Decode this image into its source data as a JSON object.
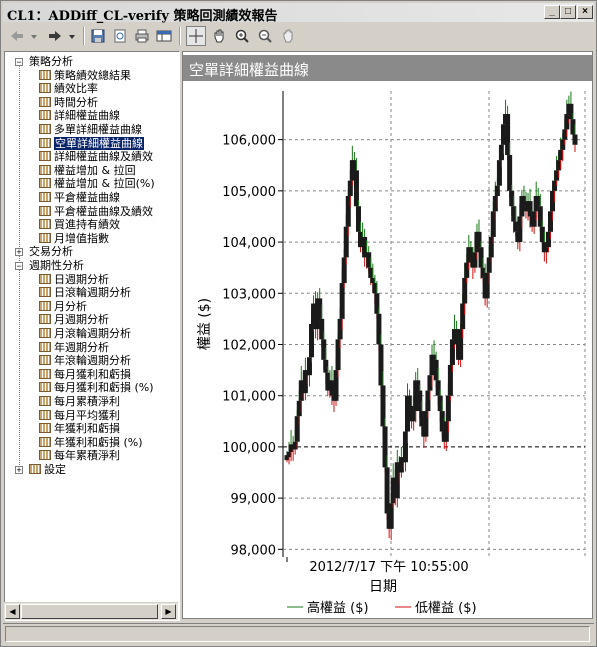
{
  "window": {
    "title": "CL1：ADDiff_CL-verify 策略回測績效報告",
    "controls": {
      "minimize": "_",
      "maximize": "□",
      "close": "×"
    }
  },
  "toolbar": {
    "icons": [
      "back-icon",
      "forward-icon",
      "save-icon",
      "preview-icon",
      "print-icon",
      "table-icon",
      "crosshair-icon",
      "hand-pan-icon",
      "zoom-in-icon",
      "zoom-out-icon",
      "reset-zoom-icon"
    ]
  },
  "tree": {
    "groups": [
      {
        "label": "策略分析",
        "expanded": true,
        "items": [
          "策略績效總結果",
          "績效比率",
          "時間分析",
          "詳細權益曲線",
          "多單詳細權益曲線",
          "空單詳細權益曲線",
          "詳細權益曲線及績效",
          "權益增加 & 拉回",
          "權益增加 & 拉回(%)",
          "平倉權益曲線",
          "平倉權益曲線及績效",
          "買進持有績效",
          "月增值指數"
        ],
        "selected": 5
      },
      {
        "label": "交易分析",
        "expanded": false,
        "items": []
      },
      {
        "label": "週期性分析",
        "expanded": true,
        "items": [
          "日週期分析",
          "日滾輪週期分析",
          "月分析",
          "月週期分析",
          "月滾輪週期分析",
          "年週期分析",
          "年滾輪週期分析",
          "每月獲利和虧損",
          "每月獲利和虧損 (%)",
          "每月累積淨利",
          "每月平均獲利",
          "年獲利和虧損",
          "年獲利和虧損 (%)",
          "每年累積淨利"
        ]
      },
      {
        "label": "設定",
        "expanded": false,
        "items": []
      }
    ]
  },
  "chart_panel": {
    "title": "空單詳細權益曲線"
  },
  "chart_data": {
    "type": "candlestick-like",
    "title": "",
    "ylabel": "權益 ($)",
    "xlabel": "日期",
    "x_tick_label": "2012/7/17 下午 10:55:00",
    "y_ticks": [
      98000,
      99000,
      100000,
      101000,
      102000,
      103000,
      104000,
      105000,
      106000
    ],
    "y_tick_labels": [
      "98,000",
      "99,000",
      "100,000",
      "101,000",
      "102,000",
      "103,000",
      "104,000",
      "105,000",
      "106,000"
    ],
    "ylim": [
      97850,
      106950
    ],
    "reference_line": 100000,
    "grid": true,
    "legend": [
      {
        "name": "高權益 ($)",
        "color": "#1a7a1a"
      },
      {
        "name": "低權益 ($)",
        "color": "#d01010"
      }
    ],
    "close_series": [
      99800,
      99900,
      100050,
      99950,
      100100,
      100600,
      100900,
      101300,
      101050,
      101500,
      101400,
      101750,
      102400,
      102800,
      102300,
      102900,
      102500,
      102100,
      101700,
      101450,
      101100,
      101300,
      101000,
      100900,
      101500,
      102100,
      102500,
      103200,
      103700,
      104300,
      104900,
      105200,
      105600,
      105400,
      104700,
      104200,
      103900,
      104100,
      103700,
      103800,
      103500,
      103300,
      103200,
      103000,
      102600,
      102000,
      101200,
      100400,
      99600,
      98700,
      98400,
      98900,
      99400,
      99000,
      99700,
      99500,
      99800,
      99700,
      100300,
      101000,
      100800,
      100500,
      100700,
      101300,
      101100,
      100700,
      100400,
      100200,
      100700,
      101100,
      101400,
      101800,
      101700,
      101300,
      101000,
      100700,
      100300,
      100100,
      100500,
      101000,
      101600,
      102100,
      102300,
      102000,
      101700,
      102300,
      102800,
      103300,
      103600,
      103900,
      103700,
      103500,
      103800,
      104200,
      103900,
      103500,
      103300,
      102900,
      103400,
      103700,
      104100,
      104600,
      104900,
      105100,
      105600,
      105900,
      106300,
      106500,
      105700,
      105000,
      104700,
      104400,
      104200,
      104000,
      104500,
      104900,
      104700,
      104600,
      104800,
      104500,
      104300,
      104600,
      104900,
      104700,
      104300,
      104000,
      103800,
      103900,
      104200,
      104600,
      105000,
      105200,
      105400,
      105600,
      105800,
      106000,
      106200,
      106500,
      106700,
      106400,
      106100,
      105900
    ]
  },
  "status": {
    "text": ""
  }
}
